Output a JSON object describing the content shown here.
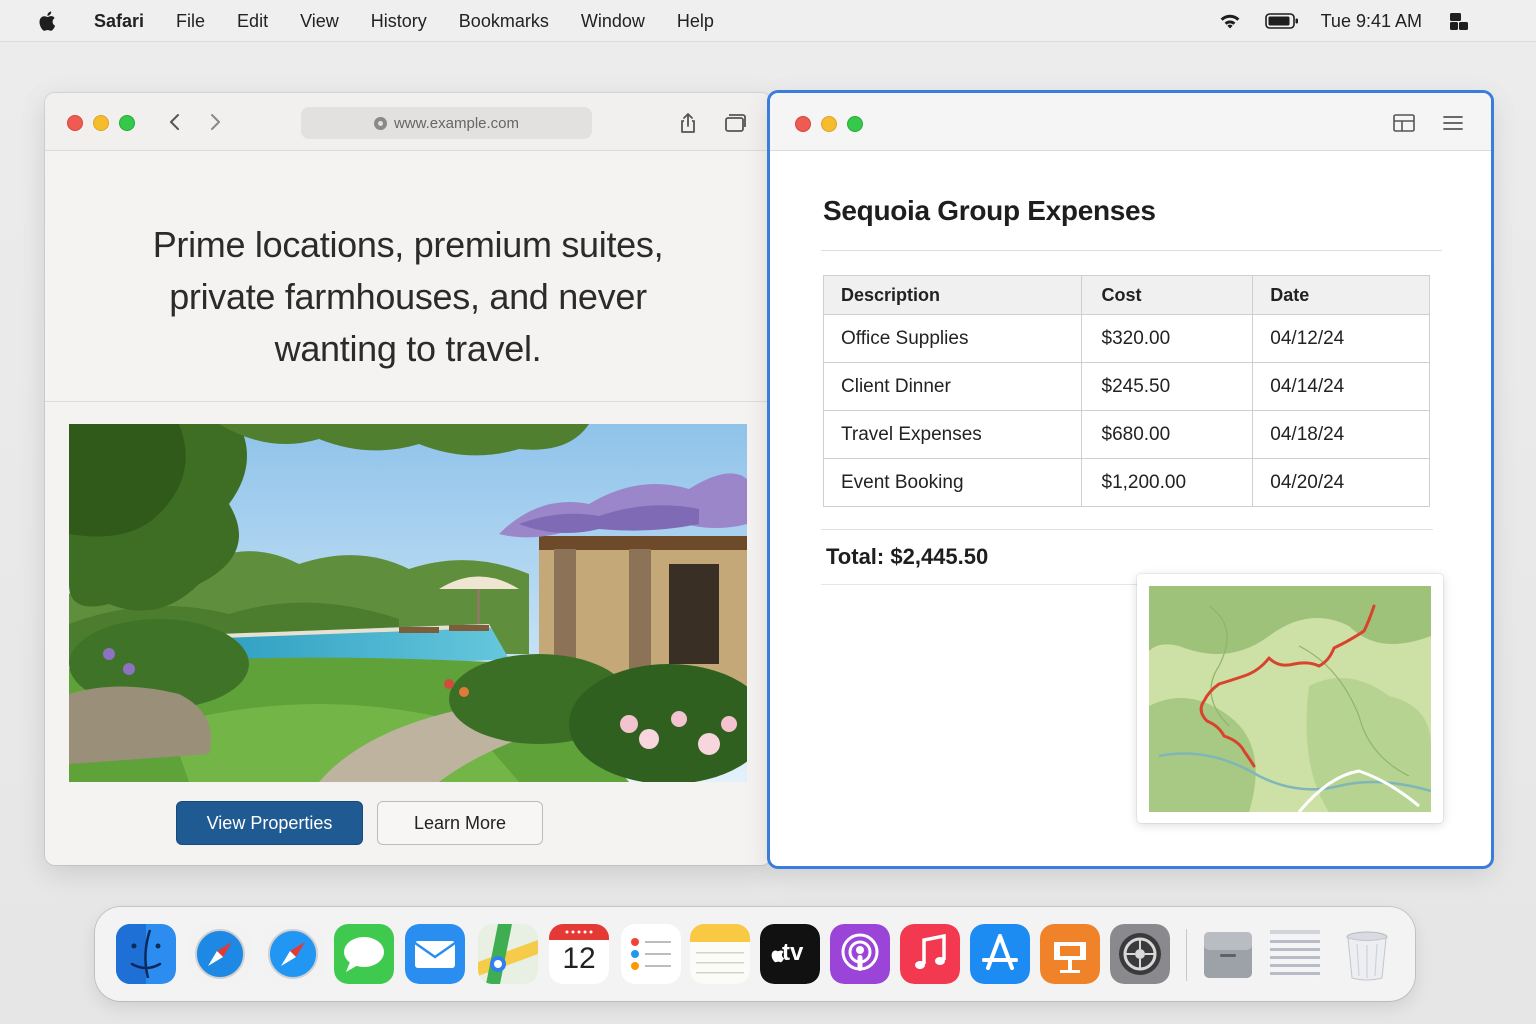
{
  "menubar": {
    "app_name": "Safari",
    "items": [
      "File",
      "Edit",
      "View",
      "History",
      "Bookmarks",
      "Window",
      "Help"
    ],
    "clock": "Tue 9:41 AM",
    "icons": [
      "apple-icon",
      "wifi-icon",
      "battery-icon",
      "control-center-icon"
    ]
  },
  "browser": {
    "url": "www.example.com",
    "hero_lines": [
      "Prime locations, premium suites,",
      "private farmhouses, and never",
      "wanting to travel."
    ],
    "primary_button": "View Properties",
    "secondary_button": "Learn More",
    "accent_color": "#1f5a92"
  },
  "document": {
    "title": "Sequoia Group Expenses",
    "columns": [
      "Description",
      "Cost",
      "Date"
    ],
    "rows": [
      {
        "description": "Office Supplies",
        "cost": "$320.00",
        "date": "04/12/24"
      },
      {
        "description": "Client Dinner",
        "cost": "$245.50",
        "date": "04/14/24"
      },
      {
        "description": "Travel Expenses",
        "cost": "$680.00",
        "date": "04/18/24"
      },
      {
        "description": "Event Booking",
        "cost": "$1,200.00",
        "date": "04/20/24"
      }
    ],
    "total": "Total: $2,445.50",
    "focus_color": "#3b7ddd"
  },
  "dock": {
    "apps": [
      "finder-icon",
      "safari-icon",
      "safari-icon",
      "messages-icon",
      "mail-icon",
      "maps-icon",
      "calendar-icon",
      "reminders-icon",
      "notes-icon",
      "tv-icon",
      "podcasts-icon",
      "music-icon",
      "app-store-icon",
      "keynote-icon",
      "system-settings-icon",
      "folder-icon",
      "document-icon",
      "trash-icon"
    ],
    "calendar_day": "12",
    "tv_label": "tv"
  }
}
